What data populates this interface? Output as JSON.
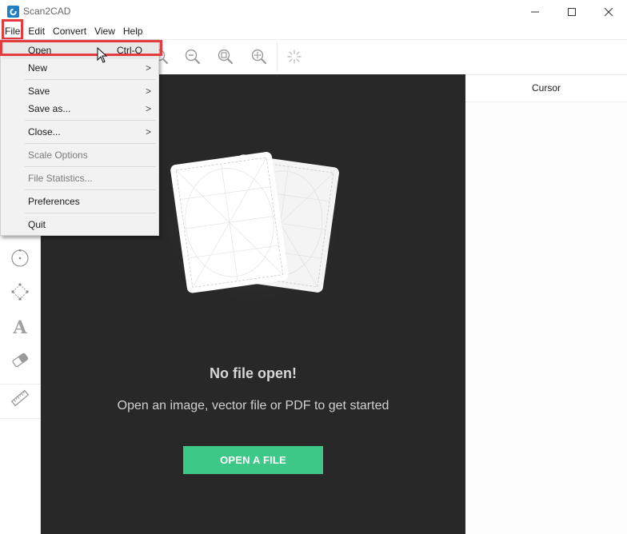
{
  "window": {
    "title": "Scan2CAD",
    "controls": {
      "minimize": "minimize",
      "maximize": "maximize",
      "close": "close"
    }
  },
  "menubar": {
    "items": [
      {
        "label": "File"
      },
      {
        "label": "Edit"
      },
      {
        "label": "Convert"
      },
      {
        "label": "View"
      },
      {
        "label": "Help"
      }
    ]
  },
  "toolbar": {
    "buttons": [
      {
        "icon": "zoom-in-partial-icon"
      },
      {
        "icon": "zoom-out-icon"
      },
      {
        "icon": "zoom-fit-icon"
      },
      {
        "icon": "zoom-pan-icon"
      },
      {
        "icon": "loading-spinner-icon"
      }
    ]
  },
  "sidebar": {
    "tools": [
      {
        "icon": "circle-tool-icon"
      },
      {
        "icon": "polygon-tool-icon"
      },
      {
        "icon": "text-tool-icon"
      },
      {
        "icon": "eraser-tool-icon"
      },
      {
        "icon": "measure-tool-icon"
      }
    ]
  },
  "canvas": {
    "empty_title": "No file open!",
    "empty_subtitle": "Open an image, vector file or PDF to get started",
    "open_button": "OPEN A FILE",
    "accent_color": "#3ec887",
    "background_color": "#282828"
  },
  "right_panel": {
    "tab": "Cursor"
  },
  "file_menu": {
    "items": [
      {
        "label": "Open",
        "shortcut": "Ctrl-O",
        "enabled": true,
        "submenu": false,
        "hovered": true
      },
      {
        "label": "New",
        "enabled": true,
        "submenu": true
      },
      {
        "label": "Save",
        "enabled": true,
        "submenu": true
      },
      {
        "label": "Save as...",
        "enabled": true,
        "submenu": true
      },
      {
        "label": "Close...",
        "enabled": true,
        "submenu": true
      },
      {
        "label": "Scale Options",
        "enabled": false,
        "submenu": false
      },
      {
        "label": "File Statistics...",
        "enabled": false,
        "submenu": false
      },
      {
        "label": "Preferences",
        "enabled": true,
        "submenu": false
      },
      {
        "label": "Quit",
        "enabled": true,
        "submenu": false
      }
    ],
    "submenu_arrow": ">"
  },
  "annotation": {
    "highlight_color": "#e53a3e"
  }
}
